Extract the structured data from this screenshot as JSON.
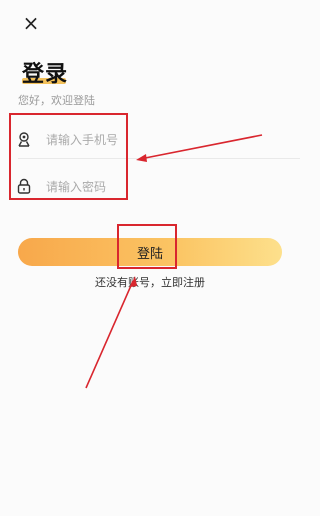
{
  "header": {
    "close_glyph": "×",
    "title": "登录",
    "subtitle": "您好，欢迎登陆"
  },
  "form": {
    "phone": {
      "placeholder": "请输入手机号",
      "icon": "user-icon"
    },
    "password": {
      "placeholder": "请输入密码",
      "icon": "lock-icon"
    }
  },
  "actions": {
    "login_label": "登陆",
    "register_text": "还没有账号，立即注册"
  },
  "colors": {
    "accent_start": "#f8a84b",
    "accent_end": "#fde08c",
    "title_highlight": "#f3c15a",
    "annotation": "#d9262e"
  }
}
